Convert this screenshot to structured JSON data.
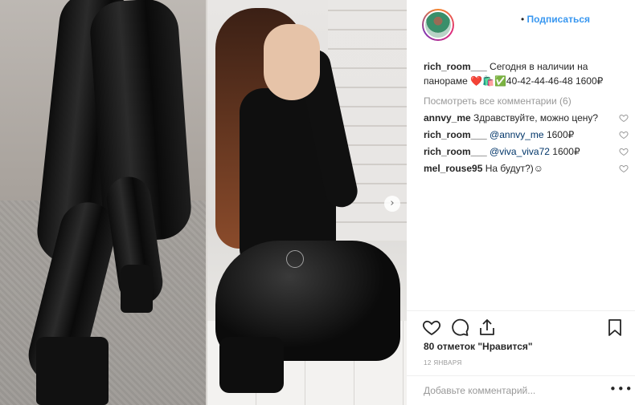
{
  "post": {
    "follow_label": "Подписаться",
    "follow_dot": "•"
  },
  "caption": {
    "username": "rich_room___",
    "text": "Сегодня в наличии на панораме ❤️🛍️✅40-42-44-46-48 1600₽"
  },
  "view_all": "Посмотреть все комментарии (6)",
  "comments": [
    {
      "username": "annvy_me",
      "text": "Здравствуйте, можно цену?",
      "mention": ""
    },
    {
      "username": "rich_room___",
      "mention": "@annvy_me",
      "text": "1600₽"
    },
    {
      "username": "rich_room___",
      "mention": "@viva_viva72",
      "text": "1600₽"
    },
    {
      "username": "mel_rouse95",
      "text": "На    будут?)☺",
      "mention": ""
    }
  ],
  "likes": "80 отметок \"Нравится\"",
  "date": "12 ЯНВАРЯ",
  "add_comment_placeholder": "Добавьте комментарий...",
  "more_label": "•••",
  "next_arrow": "›",
  "icons": [
    "heart-icon",
    "comment-icon",
    "share-icon",
    "bookmark-icon",
    "heart-small-icon"
  ]
}
